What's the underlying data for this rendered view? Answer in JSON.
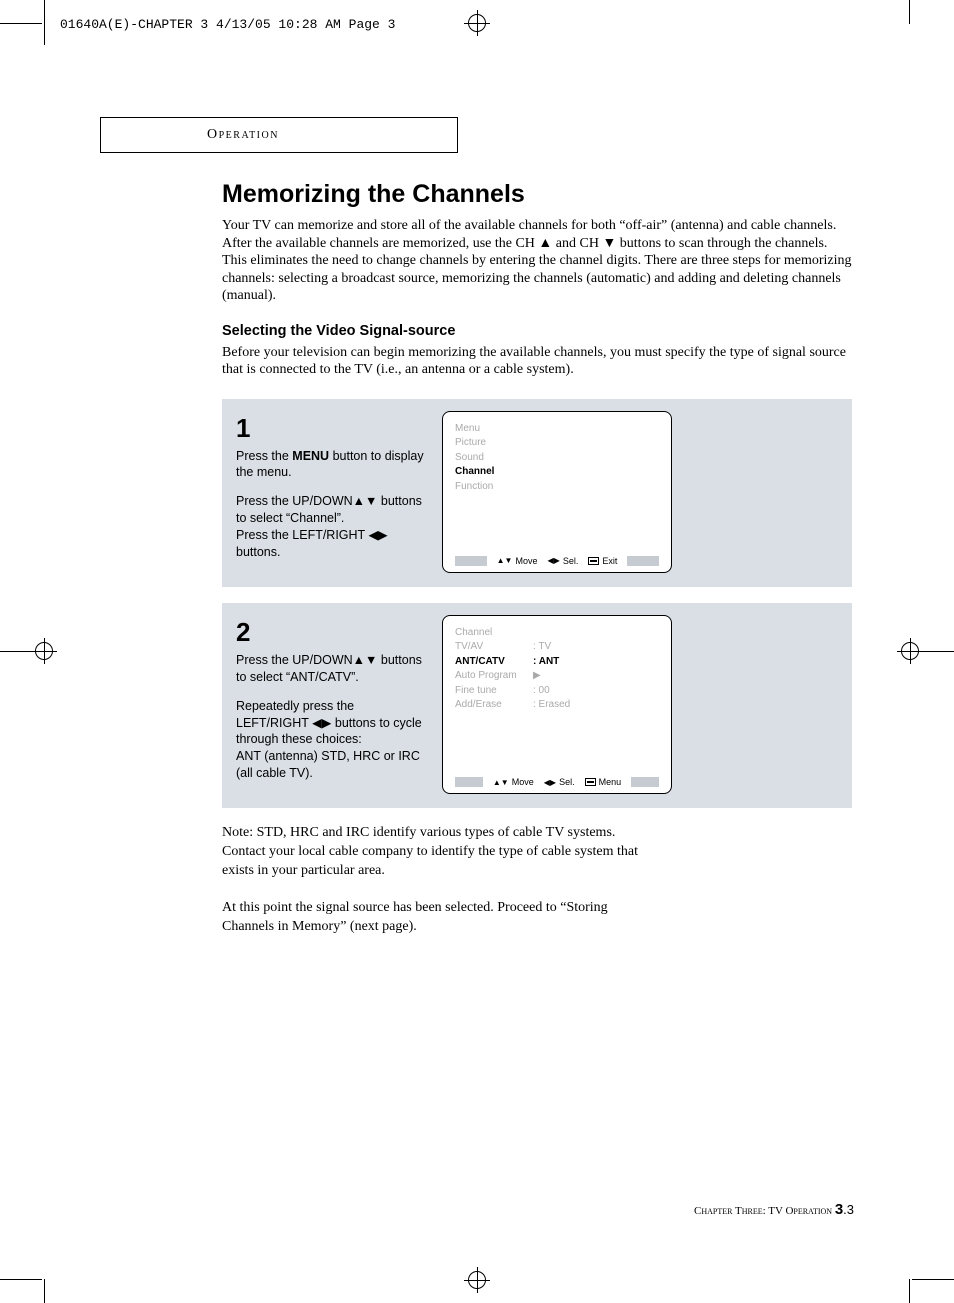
{
  "meta_header": "01640A(E)-CHAPTER 3  4/13/05  10:28 AM  Page 3",
  "section_tab": "Operation",
  "title": "Memorizing the Channels",
  "intro": "Your TV can memorize and store all of the available channels for both “off-air” (antenna) and cable channels. After the available channels are memorized, use the CH ▲ and CH ▼ buttons to scan through the channels. This eliminates the need to change channels by entering the channel digits. There are three steps for memorizing channels: selecting a broadcast source, memorizing the channels (automatic) and adding and deleting channels (manual).",
  "subtitle": "Selecting the Video Signal-source",
  "subdesc": "Before your television can begin memorizing the available channels, you must specify the type of signal source that is connected to the TV (i.e., an antenna or a cable system).",
  "step1": {
    "num": "1",
    "text1a": "Press the ",
    "text1b": "MENU",
    "text1c": " button to display the menu.",
    "text2": "Press the UP/DOWN▲▼ buttons to select “Channel”.",
    "text3": "Press the LEFT/RIGHT ◀▶ buttons.",
    "menu": {
      "header": "Menu",
      "items": [
        "Picture",
        "Sound",
        "Channel",
        "Function"
      ],
      "active_index": 2,
      "footer": {
        "move": "Move",
        "sel": "Sel.",
        "action": "Exit"
      }
    }
  },
  "step2": {
    "num": "2",
    "text1": "Press the UP/DOWN▲▼ buttons to select “ANT/CATV”.",
    "text2": "Repeatedly press the LEFT/RIGHT ◀▶ buttons to cycle  through these choices:",
    "text3": "ANT (antenna) STD, HRC or IRC (all cable TV).",
    "menu": {
      "header": "Channel",
      "rows": [
        {
          "label": "TV/AV",
          "value": ": TV"
        },
        {
          "label": "ANT/CATV",
          "value": ": ANT"
        },
        {
          "label": "Auto Program",
          "value": "▶"
        },
        {
          "label": "Fine tune",
          "value": ": 00"
        },
        {
          "label": "Add/Erase",
          "value": ": Erased"
        }
      ],
      "active_index": 1,
      "footer": {
        "move": "Move",
        "sel": "Sel.",
        "action": "Menu"
      }
    }
  },
  "note1": "Note: STD, HRC and IRC  identify various types of cable TV systems. Contact your local cable company to identify the type of cable system that exists in your particular area.",
  "note2": "At this point the signal source has been selected. Proceed to “Storing Channels in Memory” (next page).",
  "footer": {
    "chapter": "Chapter Three: TV Operation ",
    "page_major": "3",
    "page_minor": ".3"
  }
}
